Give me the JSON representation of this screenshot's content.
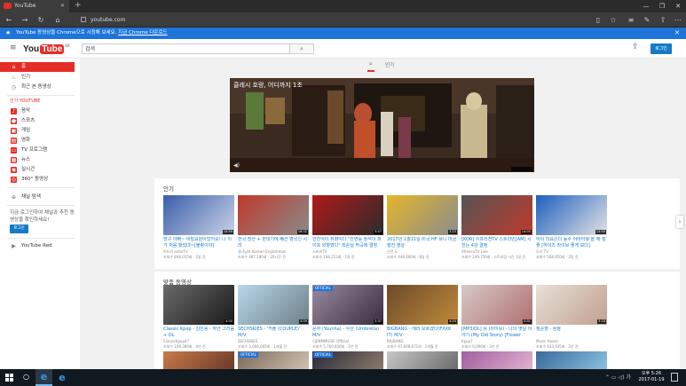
{
  "browser": {
    "tab_title": "YouTube",
    "tab_close": "✕",
    "new_tab": "+",
    "url": "youtube.com",
    "banner_text": "YouTube 동영상을 Chrome으로 시청해 보세요.",
    "banner_link": "지금 Chrome 다운로드",
    "banner_close": "✕"
  },
  "header": {
    "logo_you": "You",
    "logo_tube": "Tube",
    "logo_region": "KR",
    "search_value": "검색",
    "login": "로그인"
  },
  "sidebar": {
    "top_items": [
      {
        "label": "홈",
        "icon": "home-icon"
      },
      {
        "label": "인기",
        "icon": "fire-icon"
      },
      {
        "label": "최근 본 동영상",
        "icon": "history-icon"
      }
    ],
    "best_title": "인기 YOUTUBE",
    "best_items": [
      {
        "label": "음악",
        "icon": "music-icon"
      },
      {
        "label": "스포츠",
        "icon": "sports-icon"
      },
      {
        "label": "게임",
        "icon": "gaming-icon"
      },
      {
        "label": "영화",
        "icon": "film-icon"
      },
      {
        "label": "TV 프로그램",
        "icon": "tv-icon"
      },
      {
        "label": "뉴스",
        "icon": "news-icon"
      },
      {
        "label": "실시간",
        "icon": "live-icon"
      },
      {
        "label": "360° 동영상",
        "icon": "360-icon"
      }
    ],
    "browse_channels": "채널 탐색",
    "hint": "지금 로그인하여 채널과 추천 동영상을 확인하세요!",
    "login": "로그인",
    "red": "YouTube Red"
  },
  "main": {
    "tab_home": "홈",
    "tab_trending": "인기",
    "featured_title": "클레시 호랑, 어디까지 1초",
    "trending_title": "인기",
    "recommended_title": "맞춤 동영상",
    "trending": [
      {
        "title": "방구 이뻐~ 비밀요원이었어요! 나 이기 처음 봤었대~[불랑이야]",
        "channel": "허티키 actorTV",
        "meta": "조회수 848,015회 · 2일 전",
        "dur": "10:59",
        "c1": "#3b5da8",
        "c2": "#c9d3e8"
      },
      {
        "title": "한국 방산 + 반대기에 빼건 영국신 시리",
        "channel": "영국남자 Korean Englishman",
        "meta": "조회수 487,180회 · 20시간 전",
        "dur": "16:32",
        "c1": "#c0392b",
        "c2": "#8a8a8a"
      },
      {
        "title": "안진식이 취향이다 \"잔변증 정석이 파이프 외향였다\" 최순실 막곡에 결정",
        "channel": "스포츠TV",
        "meta": "조회수 194,211회 · 1일 전",
        "dur": "3:57",
        "c1": "#b01919",
        "c2": "#2c2c2c"
      },
      {
        "title": "2017년 1월11일 미국 HF 브니 미금행진 영상",
        "channel": "곤란 도",
        "meta": "조회수 448,400회 · 8일 전",
        "dur": "3:23",
        "c1": "#e4b62b",
        "c2": "#8c8c8c"
      },
      {
        "title": "[KOR] 이프리전TV 스트리민[AM] 시한는 4강 결정",
        "channel": "AfreecaTV Live",
        "meta": "조회수 249,750회 · 스트리밍 시간 1일 전",
        "dur": "14:05",
        "c1": "#555",
        "c2": "#c0392b"
      },
      {
        "title": "하이 미요즌다 동수 어떠어떻 쓸 해 짐 좋 [하이즈 라이브 좋게 보다]",
        "channel": "도티 TV",
        "meta": "조회수 568,850회 · 2일 전",
        "dur": "14:00",
        "c1": "#1e5fbf",
        "c2": "#e3e3e3"
      }
    ],
    "recommended": [
      {
        "title": "Classic Kpop - 김민용 - 하얀 그리움 + DL",
        "channel": "ClassicKpop47",
        "meta": "조회수 109,389회 · 4년 전",
        "dur": "4:33",
        "c1": "#6a6a6a",
        "c2": "#1a1a1a"
      },
      {
        "title": "SECHSKIES - '커플 (COUPLE)' M/V",
        "channel": "SECHSKIES",
        "meta": "조회수 3,094,665회 · 1개월 전",
        "dur": "4:09",
        "c1": "#b9d7ea",
        "c2": "#6e7f88"
      },
      {
        "title": "윤하 (Younha) - 우산 (Umbrella) M/V",
        "channel": "CJENMMUSIC Official",
        "meta": "조회수 5,760,856회 · 3년 전",
        "dur": "3:37",
        "c1": "#9a8aa0",
        "c2": "#3a2d3e"
      },
      {
        "title": "BIGBANG - 에라 모르겠다(FXXK IT) M/V",
        "channel": "BIGBANG",
        "meta": "조회수 47,608,671회 · 1개월 전",
        "dur": "4:04",
        "c1": "#6b4a2a",
        "c2": "#c08a3a"
      },
      {
        "title": "[MP3/DL] 뮤 (아이유) - 나의 옛날 이야기 (My Old Story) [Flower",
        "channel": "Kpop7",
        "meta": "조회수 0,000회 · 3년 전",
        "dur": "4:01",
        "c1": "#d8c8c8",
        "c2": "#b07070"
      },
      {
        "title": "정준영 - 꿈을",
        "channel": "Music Hooks",
        "meta": "조회수 433,935회 · 2년 전",
        "dur": "3:18",
        "c1": "#e8e0d8",
        "c2": "#c0a090"
      }
    ],
    "third_row": [
      {
        "c1": "#c97a4a",
        "c2": "#6a3a2a"
      },
      {
        "c1": "#7a6a5a",
        "c2": "#d0c0b0"
      },
      {
        "c1": "#2a2a3a",
        "c2": "#8a7a6a"
      },
      {
        "c1": "#c8c8c8",
        "c2": "#6a6a6a"
      },
      {
        "c1": "#a060a0",
        "c2": "#e0b0d0"
      },
      {
        "c1": "#3a6a9a",
        "c2": "#8ac0e0"
      }
    ],
    "official_badge": "OFFICIAL"
  },
  "taskbar": {
    "clock_time": "오후 5:26",
    "clock_date": "2017-01-19",
    "ime": "가"
  }
}
